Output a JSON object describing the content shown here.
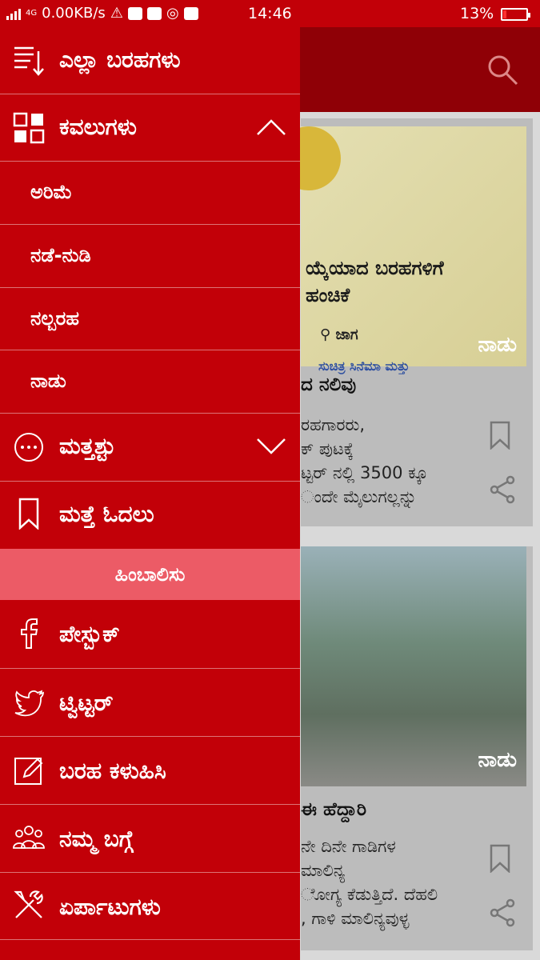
{
  "status_bar": {
    "network_type": "4G",
    "speed": "0.00KB/s",
    "time": "14:46",
    "battery_percent": "13%",
    "battery_level": 0.13,
    "battery_color": "#ff3030"
  },
  "colors": {
    "drawer_bg": "#c20008",
    "header_bg": "#8f0006",
    "follow_bg": "#ec5b66"
  },
  "drawer": {
    "all_posts": "ಎಲ್ಲಾ ಬರಹಗಳು",
    "categories": "ಕವಲುಗಳು",
    "sub_items": [
      "ಅರಿಮೆ",
      "ನಡೆ-ನುಡಿ",
      "ನಲ್ಬರಹ",
      "ನಾಡು"
    ],
    "more": "ಮತ್ತಶ್ಟು",
    "read_later": "ಮತ್ತೆ ಓದಲು",
    "follow_header": "ಹಿಂಬಾಲಿಸು",
    "facebook": "ಪೇಸ್ಬುಕ್",
    "twitter": "ಟ್ವಿಟ್ಟರ್",
    "submit": "ಬರಹ ಕಳುಹಿಸಿ",
    "about": "ನಮ್ಮ ಬಗ್ಗೆ",
    "settings": "ಏರ್ಪಾಟುಗಳು"
  },
  "background": {
    "card1": {
      "image_title": "ಯ್ಕೆಯಾದ ಬರಹಗಳಿಗೆ\nಹಂಚಿಕೆ",
      "image_author": "ಜಾಗ",
      "image_sub": "ಸುಚಿತ್ರ ಸಿನೆಮಾ ಮತ್ತು",
      "tag": "ನಾಡು",
      "title": "ದ ನಲಿವು",
      "excerpt": "ರಹಗಾರರು,\nಕ್ ಪುಟಕ್ಕೆ\nಟ್ಟರ್ ನಲ್ಲಿ 3500 ಕ್ಕೂ\nಂದೇ ಮೈಲುಗಲ್ಲನ್ನು"
    },
    "card2": {
      "tag": "ನಾಡು",
      "title": "ಈ ಹೆದ್ದಾರಿ",
      "excerpt": "ನೇ ದಿನೇ ಗಾಡಿಗಳ\nಮಾಲಿನ್ಯ\nೋಗ್ಯ ಕೆಡುತ್ತಿದೆ. ದೆಹಲಿ\n, ಗಾಳಿ ಮಾಲಿನ್ಯವುಳ್ಳ"
    }
  }
}
